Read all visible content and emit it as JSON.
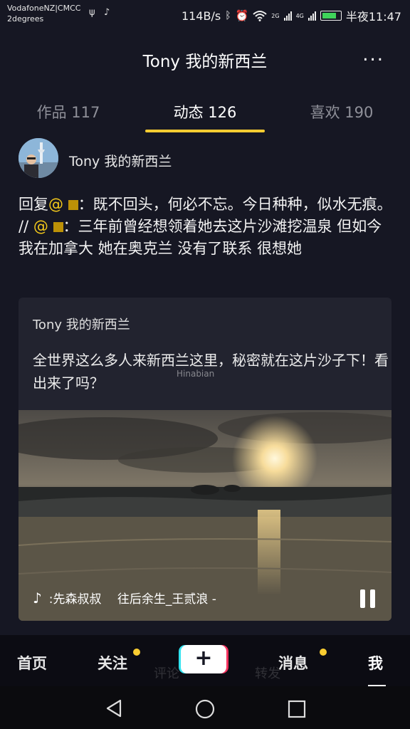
{
  "status_bar": {
    "carrier_line1": "VodafoneNZ|CMCC",
    "carrier_line2": "2degrees",
    "speed": "114B/s",
    "net_2g": "2G",
    "net_4g": "4G",
    "time": "半夜11:47",
    "battery_level": 0.68
  },
  "header": {
    "title": "Tony 我的新西兰",
    "more": "..."
  },
  "tabs": [
    {
      "label": "作品 117",
      "active": false
    },
    {
      "label": "动态 126",
      "active": true
    },
    {
      "label": "喜欢 190",
      "active": false
    }
  ],
  "post": {
    "author": "Tony 我的新西兰",
    "reply_prefix": "回复",
    "mention_1": "@",
    "text_1": "：既不回头，何必不忘。今日种种，似水无痕。 // ",
    "mention_2": "@",
    "text_2": "：三年前曾经想领着她去这片沙滩挖温泉 但如今 我在加拿大 她在奥克兰 没有了联系 很想她"
  },
  "repost": {
    "author": "Tony 我的新西兰",
    "text": "全世界这么多人来新西兰这里，秘密就在这片沙子下！看出来了吗？",
    "watermark": "Hinabian",
    "music": ":先森叔叔　 往后余生_王贰浪 -"
  },
  "bottom_nav": {
    "home": "首页",
    "follow": "关注",
    "add": "+",
    "messages": "消息",
    "me": "我",
    "ghost_comment": "评论",
    "ghost_share": "转发"
  },
  "colors": {
    "background": "#161723",
    "accent_yellow": "#facd31",
    "mention": "#f4c91b"
  }
}
